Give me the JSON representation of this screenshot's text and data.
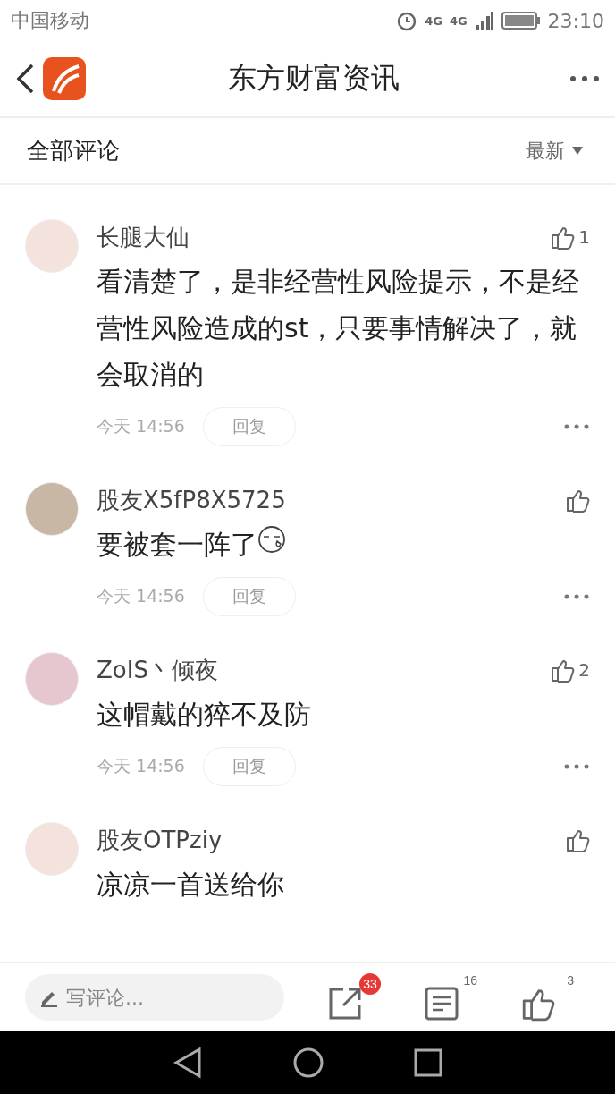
{
  "status_bar": {
    "carrier": "中国移动",
    "network_a": "4G",
    "network_b": "4G",
    "time": "23:10"
  },
  "header": {
    "title": "东方财富资讯"
  },
  "comments_header": {
    "title": "全部评论",
    "sort": "最新"
  },
  "comments": [
    {
      "user": "长腿大仙",
      "likes": "1",
      "text": "看清楚了，是非经营性风险提示，不是经营性风险造成的st，只要事情解决了，就会取消的",
      "emoji": false,
      "time": "今天 14:56",
      "reply": "回复"
    },
    {
      "user": "股友X5fP8X5725",
      "text": "要被套一阵了",
      "emoji": true,
      "time": "今天 14:56",
      "reply": "回复"
    },
    {
      "user": "ZoIS丶倾夜",
      "likes": "2",
      "text": "这帽戴的猝不及防",
      "emoji": false,
      "time": "今天 14:56",
      "reply": "回复"
    },
    {
      "user": "股友OTPziy",
      "text": "凉凉一首送给你",
      "emoji": false
    }
  ],
  "bottom_bar": {
    "comment_placeholder": "写评论...",
    "share_badge": "33",
    "comments_count": "16",
    "likes_count": "3"
  }
}
